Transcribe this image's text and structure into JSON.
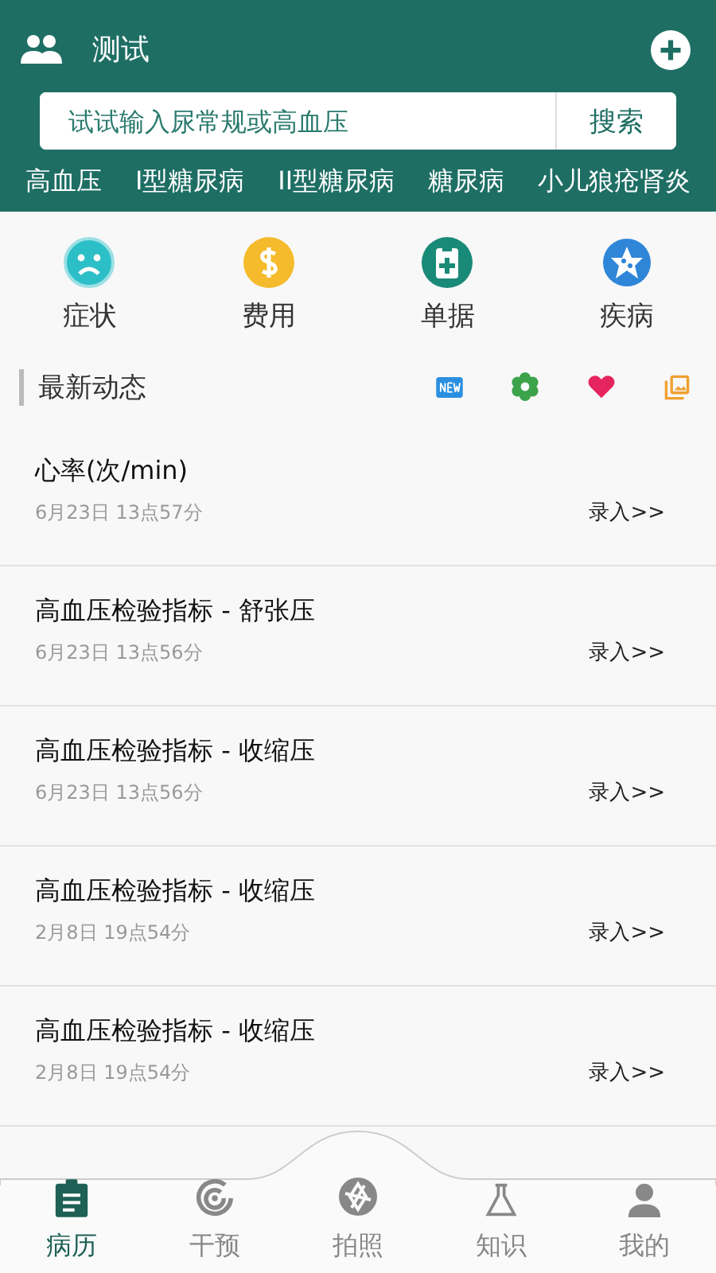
{
  "header": {
    "title": "测试"
  },
  "search": {
    "placeholder": "试试输入尿常规或高血压",
    "button": "搜索"
  },
  "hot_tags": [
    "高血压",
    "I型糖尿病",
    "II型糖尿病",
    "糖尿病",
    "小儿狼疮肾炎"
  ],
  "categories": [
    {
      "kind": "symptom",
      "label": "症状"
    },
    {
      "kind": "cost",
      "label": "费用"
    },
    {
      "kind": "receipt",
      "label": "单据"
    },
    {
      "kind": "disease",
      "label": "疾病"
    }
  ],
  "section": {
    "title": "最新动态"
  },
  "records": [
    {
      "title": "心率(次/min)",
      "date": "6月23日 13点57分",
      "action": "录入>>"
    },
    {
      "title": "高血压检验指标 - 舒张压",
      "date": "6月23日 13点56分",
      "action": "录入>>"
    },
    {
      "title": "高血压检验指标 - 收缩压",
      "date": "6月23日 13点56分",
      "action": "录入>>"
    },
    {
      "title": "高血压检验指标 - 收缩压",
      "date": "2月8日 19点54分",
      "action": "录入>>"
    },
    {
      "title": "高血压检验指标 - 收缩压",
      "date": "2月8日 19点54分",
      "action": "录入>>"
    }
  ],
  "tabs": [
    {
      "kind": "records",
      "label": "病历",
      "selected": true
    },
    {
      "kind": "intervene",
      "label": "干预",
      "selected": false
    },
    {
      "kind": "camera",
      "label": "拍照",
      "selected": false
    },
    {
      "kind": "knowledge",
      "label": "知识",
      "selected": false
    },
    {
      "kind": "me",
      "label": "我的",
      "selected": false
    }
  ]
}
